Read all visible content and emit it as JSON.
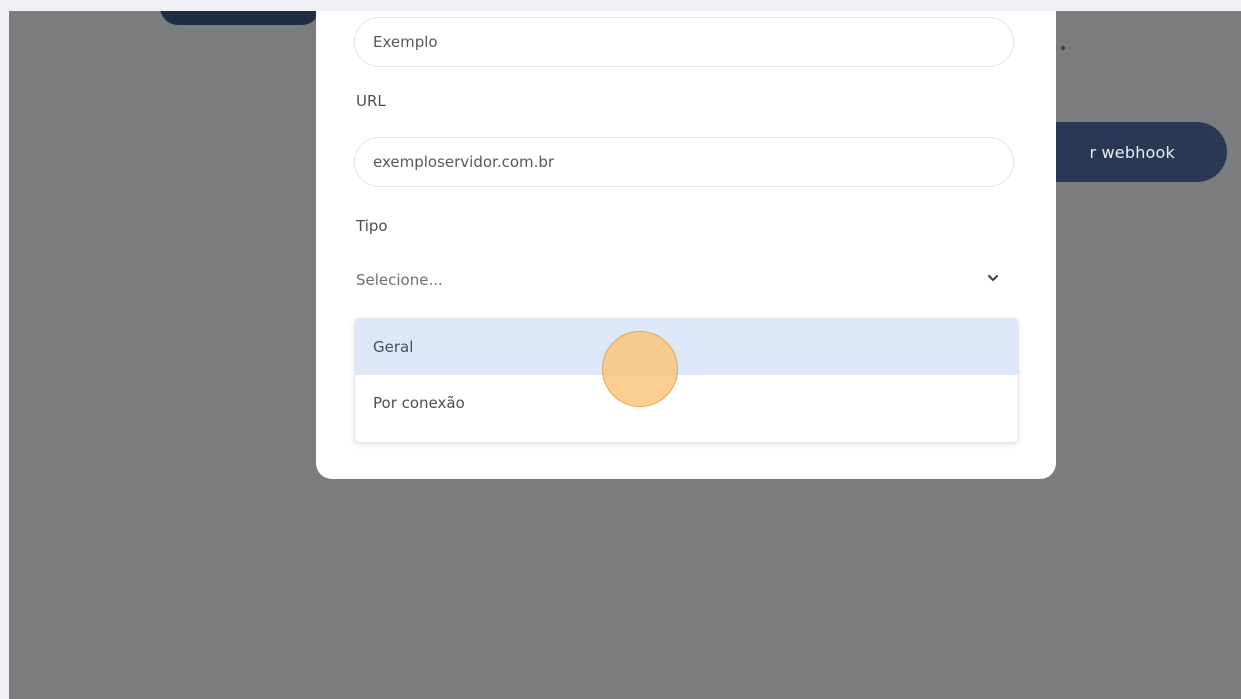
{
  "background": {
    "button_label": "r webhook"
  },
  "modal": {
    "name_field": {
      "value": "Exemplo"
    },
    "url_field": {
      "label": "URL",
      "value": "exemploservidor.com.br"
    },
    "type_field": {
      "label": "Tipo",
      "placeholder": "Selecione...",
      "options": [
        "Geral",
        "Por conexão"
      ],
      "highlighted_option": "Geral"
    }
  },
  "colors": {
    "overlay": "#7b7c7e",
    "dark_button": "#2a3953",
    "option_highlight": "#dce8f8",
    "cursor_marker": "#f7c27a"
  },
  "icons": {
    "select_toggle": "chevron-down-icon"
  }
}
